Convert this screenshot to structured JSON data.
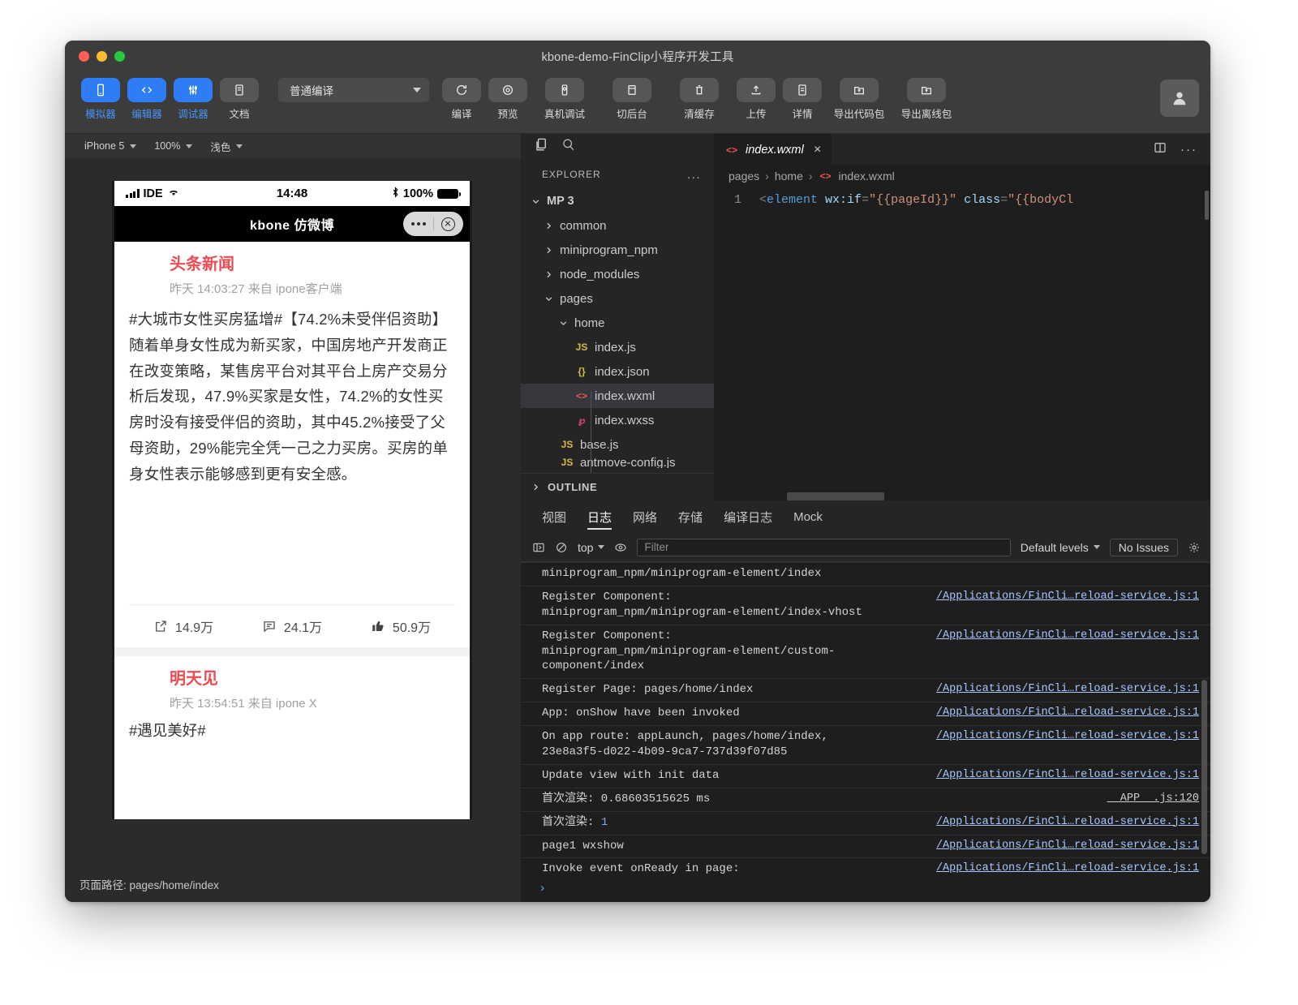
{
  "window": {
    "title": "kbone-demo-FinClip小程序开发工具"
  },
  "toolbar": {
    "primary": [
      {
        "label": "模拟器",
        "icon": "phone-icon",
        "active": true
      },
      {
        "label": "编辑器",
        "icon": "code-icon",
        "active": true
      },
      {
        "label": "调试器",
        "icon": "debug-icon",
        "active": true
      },
      {
        "label": "文档",
        "icon": "doc-icon",
        "active": false
      }
    ],
    "compile_mode": "普通编译",
    "actions": [
      {
        "label": "编译",
        "icon": "refresh-icon"
      },
      {
        "label": "预览",
        "icon": "target-icon"
      },
      {
        "label": "真机调试",
        "icon": "device-icon"
      },
      {
        "label": "切后台",
        "icon": "window-icon"
      },
      {
        "label": "清缓存",
        "icon": "trash-icon"
      },
      {
        "label": "上传",
        "icon": "upload-icon"
      },
      {
        "label": "详情",
        "icon": "info-doc-icon"
      },
      {
        "label": "导出代码包",
        "icon": "export-folder-icon"
      },
      {
        "label": "导出离线包",
        "icon": "export-offline-icon"
      }
    ],
    "avatar": "user-avatar-icon"
  },
  "simulator": {
    "device": "iPhone 5",
    "zoom": "100%",
    "theme": "浅色",
    "status_bar": {
      "carrier": "IDE",
      "time": "14:48",
      "battery": "100%"
    },
    "nav_title": "kbone 仿微博",
    "posts": [
      {
        "user": "头条新闻",
        "meta": "昨天 14:03:27 来自 ipone客户端",
        "text": "#大城市女性买房猛增#【74.2%未受伴侣资助】随着单身女性成为新买家，中国房地产开发商正在改变策略，某售房平台对其平台上房产交易分析后发现，47.9%买家是女性，74.2%的女性买房时没有接受伴侣的资助，其中45.2%接受了父母资助，29%能完全凭一己之力买房。买房的单身女性表示能够感到更有安全感。",
        "actions": [
          {
            "icon": "share-icon",
            "count": "14.9万"
          },
          {
            "icon": "comment-icon",
            "count": "24.1万"
          },
          {
            "icon": "like-icon",
            "count": "50.9万"
          }
        ]
      },
      {
        "user": "明天见",
        "meta": "昨天 13:54:51 来自 ipone X",
        "text": "#遇见美好#"
      }
    ],
    "status_text": "页面路径: pages/home/index"
  },
  "explorer": {
    "title": "EXPLORER",
    "more": "...",
    "tree": [
      {
        "label": "MP 3",
        "type": "root",
        "expanded": true,
        "depth": 0
      },
      {
        "label": "common",
        "type": "folder",
        "expanded": false,
        "depth": 1
      },
      {
        "label": "miniprogram_npm",
        "type": "folder",
        "expanded": false,
        "depth": 1
      },
      {
        "label": "node_modules",
        "type": "folder",
        "expanded": false,
        "depth": 1
      },
      {
        "label": "pages",
        "type": "folder",
        "expanded": true,
        "depth": 1
      },
      {
        "label": "home",
        "type": "folder",
        "expanded": true,
        "depth": 2
      },
      {
        "label": "index.js",
        "type": "js",
        "depth": 3,
        "badge": "JS"
      },
      {
        "label": "index.json",
        "type": "json",
        "depth": 3,
        "badge": "{}"
      },
      {
        "label": "index.wxml",
        "type": "wxml",
        "depth": 3,
        "badge": "<>",
        "selected": true
      },
      {
        "label": "index.wxss",
        "type": "wxss",
        "depth": 3,
        "badge": "℘"
      },
      {
        "label": "base.js",
        "type": "js",
        "depth": 2,
        "badge": "JS"
      },
      {
        "label": "antmove-config.js",
        "type": "js",
        "depth": 2,
        "badge": "JS",
        "clipped": true
      }
    ],
    "outline": "OUTLINE"
  },
  "editor": {
    "tab": {
      "label": "index.wxml",
      "badge": "<>",
      "close": "×"
    },
    "breadcrumb": [
      "pages",
      "home",
      "index.wxml"
    ],
    "breadcrumb_badge": "<>",
    "line_number": "1",
    "code": {
      "open": "<",
      "tag": "element",
      "space1": " ",
      "attr1": "wx:if",
      "eq1": "=",
      "val1": "\"{{pageId}}\"",
      "space2": " ",
      "attr2": "class",
      "eq2": "=",
      "val2": "\"{{bodyCl"
    }
  },
  "console": {
    "tabs": [
      {
        "label": "视图",
        "active": false
      },
      {
        "label": "日志",
        "active": true
      },
      {
        "label": "网络",
        "active": false
      },
      {
        "label": "存储",
        "active": false
      },
      {
        "label": "编译日志",
        "active": false
      },
      {
        "label": "Mock",
        "active": false
      }
    ],
    "toolbar": {
      "sidebar_icon": "panel-toggle-icon",
      "clear_icon": "clear-console-icon",
      "context": "top",
      "eye_icon": "live-expression-icon",
      "filter_placeholder": "Filter",
      "levels": "Default levels",
      "issues": "No Issues",
      "settings_icon": "gear-icon"
    },
    "logs": [
      {
        "msg": "miniprogram_npm/miniprogram-element/index",
        "src": ""
      },
      {
        "msg": "Register Component:\nminiprogram_npm/miniprogram-element/index-vhost",
        "src": "/Applications/FinCli…reload-service.js:1"
      },
      {
        "msg": "Register Component:\nminiprogram_npm/miniprogram-element/custom-component/index",
        "src": "/Applications/FinCli…reload-service.js:1"
      },
      {
        "msg": "Register Page: pages/home/index",
        "src": "/Applications/FinCli…reload-service.js:1"
      },
      {
        "msg": "App: onShow have been invoked",
        "src": "/Applications/FinCli…reload-service.js:1"
      },
      {
        "msg": "On app route: appLaunch, pages/home/index,\n23e8a3f5-d022-4b09-9ca7-737d39f07d85",
        "src": "/Applications/FinCli…reload-service.js:1"
      },
      {
        "msg": "Update view with init data",
        "src": "/Applications/FinCli…reload-service.js:1"
      },
      {
        "msg": "首次渲染: 0.68603515625 ms",
        "src": "__APP__.js:120",
        "src_plain": true
      },
      {
        "msg": "首次渲染: ",
        "num": "1",
        "src": "/Applications/FinCli…reload-service.js:1"
      },
      {
        "msg": "page1 wxshow",
        "src": "/Applications/FinCli…reload-service.js:1"
      },
      {
        "msg": "Invoke event onReady in page:\n/pages/home/index",
        "src": "/Applications/FinCli…reload-service.js:1"
      }
    ],
    "prompt": "›"
  },
  "colors": {
    "accent": "#2f7df6",
    "post_user": "#eb4b52",
    "window_chrome": "#3c3c3c",
    "editor_bg": "#1e1e1e"
  }
}
